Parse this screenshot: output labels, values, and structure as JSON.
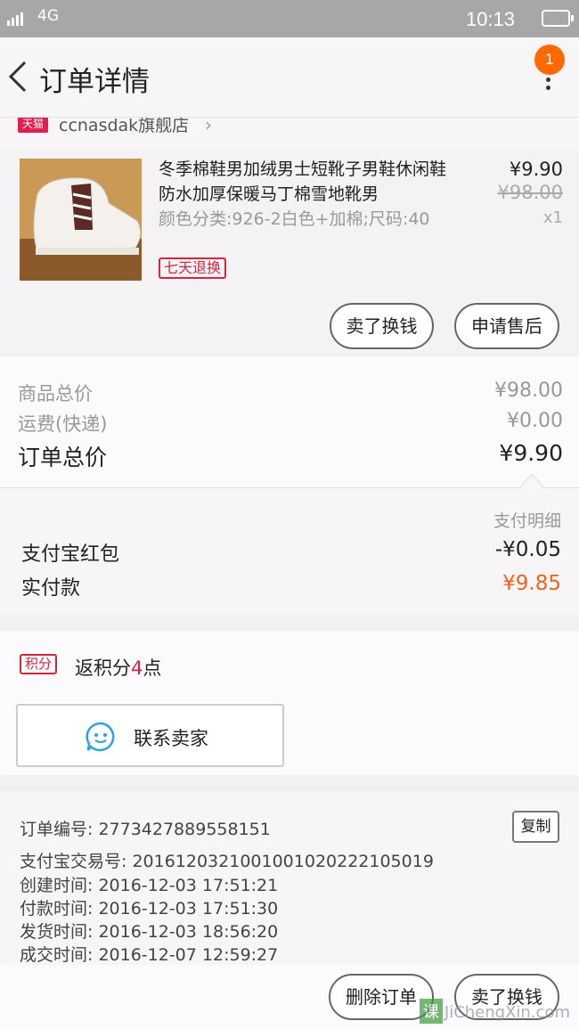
{
  "status_bar": {
    "network": "4G",
    "time": "10:13"
  },
  "nav": {
    "title": "订单详情",
    "badge_count": "1"
  },
  "shop": {
    "platform_tag": "天猫",
    "name": "ccnasdak旗舰店"
  },
  "product": {
    "name": "冬季棉鞋男加绒男士短靴子男鞋休闲鞋防水加厚保暖马丁棉雪地靴男",
    "sku": "颜色分类:926-2白色+加棉;尺码:40",
    "tag": "七天退换",
    "price": "¥9.90",
    "original_price": "¥98.00",
    "quantity": "x1",
    "buttons": {
      "sell_exchange": "卖了换钱",
      "after_sale": "申请售后"
    }
  },
  "totals": {
    "goods_label": "商品总价",
    "goods_value": "¥98.00",
    "shipping_label": "运费(快递)",
    "shipping_value": "¥0.00",
    "order_label": "订单总价",
    "order_value": "¥9.90"
  },
  "payment": {
    "detail_link": "支付明细",
    "redpacket_label": "支付宝红包",
    "redpacket_value": "-¥0.05",
    "paid_label": "实付款",
    "paid_value": "¥9.85"
  },
  "points": {
    "badge": "积分",
    "text_prefix": "返积分",
    "amount": "4",
    "text_suffix": "点"
  },
  "contact": {
    "label": "联系卖家"
  },
  "order_info": {
    "order_no": "订单编号: 2773427889558151",
    "copy_label": "复制",
    "alipay_no": "支付宝交易号: 2016120321001001020222105019",
    "created": "创建时间: 2016-12-03 17:51:21",
    "paid": "付款时间: 2016-12-03 17:51:30",
    "shipped": "发货时间: 2016-12-03 18:56:20",
    "completed": "成交时间: 2016-12-07 12:59:27"
  },
  "footer": {
    "delete_label": "删除订单",
    "sell_exchange_label": "卖了换钱"
  },
  "watermark": {
    "box": "课",
    "text": "JiChengXin.com"
  },
  "colors": {
    "accent_orange": "#f0631c",
    "tmall_red": "#e0204c",
    "badge_orange": "#ff6a00"
  }
}
